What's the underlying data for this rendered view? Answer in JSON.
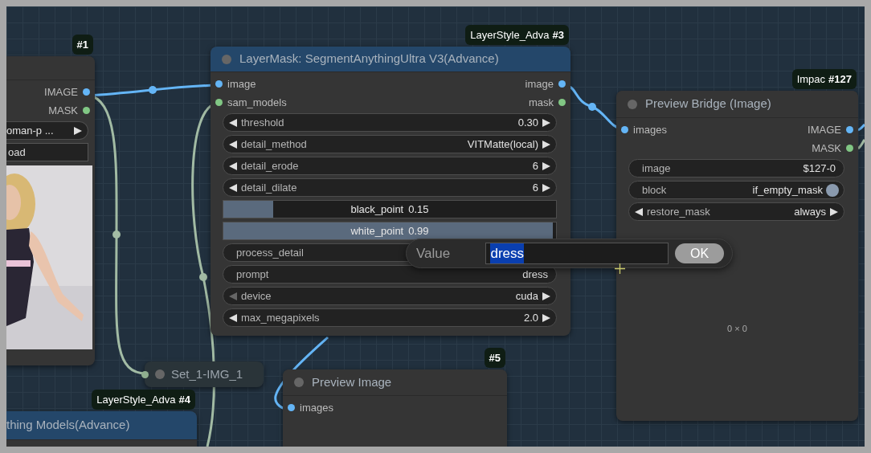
{
  "nodes": [
    {
      "badge": {
        "id": "#1"
      },
      "color": "#353535",
      "collapsed": false,
      "outputs": [
        {
          "label": "IMAGE",
          "color": "#64b5f6"
        },
        {
          "label": "MASK",
          "color": "#81c784"
        }
      ],
      "widgets": [
        {
          "kind": "partial_combo",
          "value": "oman-p ..."
        },
        {
          "kind": "button",
          "value": "oad"
        }
      ],
      "preview": {
        "kind": "picture"
      }
    },
    {
      "badge": {
        "title": "LayerStyle_Adva",
        "id": "#3"
      },
      "title": "LayerMask: SegmentAnythingUltra V3(Advance)",
      "color": "#24476a",
      "collapsed": false,
      "inputs": [
        {
          "label": "image",
          "color": "#64b5f6"
        },
        {
          "label": "sam_models",
          "color": "#81c784"
        }
      ],
      "outputs": [
        {
          "label": "image",
          "color": "#64b5f6"
        },
        {
          "label": "mask",
          "color": "#81c784"
        }
      ],
      "widgets": [
        {
          "kind": "combo",
          "label": "threshold",
          "value": "0.30",
          "left_disabled": false
        },
        {
          "kind": "combo",
          "label": "detail_method",
          "value": "VITMatte(local)",
          "left_disabled": false
        },
        {
          "kind": "combo",
          "label": "detail_erode",
          "value": "6",
          "left_disabled": false
        },
        {
          "kind": "combo",
          "label": "detail_dilate",
          "value": "6",
          "left_disabled": false
        },
        {
          "kind": "slider",
          "label": "black_point",
          "value": "0.15",
          "level": 0.15
        },
        {
          "kind": "slider",
          "label": "white_point",
          "value": "0.99",
          "level": 0.99
        },
        {
          "kind": "toggle",
          "label": "process_detail"
        },
        {
          "kind": "text",
          "label": "prompt",
          "value": "dress"
        },
        {
          "kind": "combo",
          "label": "device",
          "value": "cuda",
          "left_disabled": true
        },
        {
          "kind": "combo",
          "label": "max_megapixels",
          "value": "2.0",
          "left_disabled": false
        }
      ]
    },
    {
      "badge": {
        "title": "Impac",
        "id": "#127"
      },
      "title": "Preview Bridge (Image)",
      "color": "#353535",
      "collapsed": false,
      "inputs": [
        {
          "label": "images",
          "color": "#64b5f6"
        }
      ],
      "outputs": [
        {
          "label": "IMAGE",
          "color": "#64b5f6"
        },
        {
          "label": "MASK",
          "color": "#81c784"
        }
      ],
      "widgets": [
        {
          "kind": "text",
          "label": "image",
          "value": "$127-0"
        },
        {
          "kind": "toggle",
          "label": "block",
          "value": "if_empty_mask"
        },
        {
          "kind": "combo",
          "label": "restore_mask",
          "value": "always",
          "left_disabled": false
        }
      ],
      "preview": {
        "kind": "size",
        "text": "0 × 0"
      }
    },
    {
      "title": "Set_1-IMG_1",
      "color": "#2a3439",
      "collapsed": true,
      "inputs": [
        {
          "color": "#8fae8f"
        }
      ]
    },
    {
      "badge": {
        "id": "#5"
      },
      "title": "Preview Image",
      "color": "#353535",
      "collapsed": false,
      "inputs": [
        {
          "label": "images",
          "color": "#64b5f6"
        }
      ]
    },
    {
      "badge": {
        "title": "LayerStyle_Adva",
        "id": "#4"
      },
      "title": "thing Models(Advance)",
      "color": "#24476a",
      "collapsed": false
    }
  ],
  "dialog": {
    "label": "Value",
    "value": "dress",
    "text_selected": true,
    "button": "OK"
  }
}
